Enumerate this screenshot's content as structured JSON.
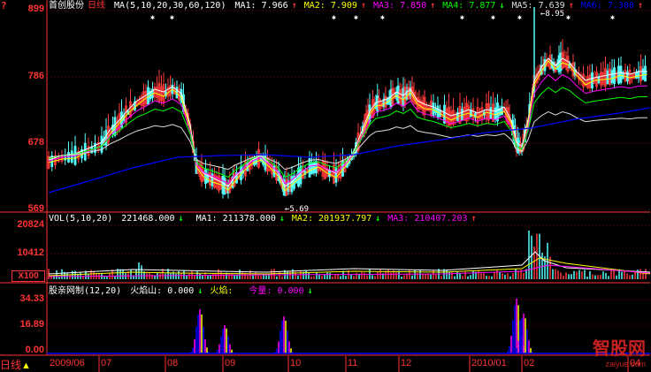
{
  "colors": {
    "up": "#ff3a3a",
    "down": "#54ffff",
    "ma1": "#ffffff",
    "ma2": "#ffff00",
    "ma3": "#ff00ff",
    "ma4": "#00ff00",
    "ma5": "#dddddd",
    "ma6": "#0000ff",
    "grid": "#8b0000",
    "axis": "#ff3333",
    "vol_ma1": "#ffffff",
    "vol_ma2": "#ffff00",
    "vol_ma3": "#ff00ff",
    "ind1": "#ffff00",
    "ind2": "#ff00ff",
    "ind3": "#0000ff"
  },
  "corner_icon": "?",
  "main_panel": {
    "y_labels": [
      "899",
      "786",
      "678",
      "569"
    ],
    "header": {
      "stock": "首创股份",
      "period": "日线",
      "ma_def": "MA(5,10,20,30,60,120)",
      "items": [
        {
          "label": "MA1:",
          "value": "7.966",
          "arrow": "↑",
          "color": "#ffffff"
        },
        {
          "label": "MA2:",
          "value": "7.909",
          "arrow": "↑",
          "color": "#ffff00"
        },
        {
          "label": "MA3:",
          "value": "7.850",
          "arrow": "↑",
          "color": "#ff00ff"
        },
        {
          "label": "MA4:",
          "value": "7.877",
          "arrow": "↓",
          "color": "#00ff00"
        },
        {
          "label": "MA5:",
          "value": "7.639",
          "arrow": "↑",
          "color": "#dddddd"
        },
        {
          "label": "MA6:",
          "value": "7.300",
          "arrow": "↑",
          "color": "#0000ff"
        }
      ]
    },
    "high_mark": "8.95",
    "low_mark": "5.69"
  },
  "vol_panel": {
    "y_labels": [
      "20824",
      "10412",
      "X100"
    ],
    "header": {
      "def": "VOL(5,10,20)",
      "value": "221468.000",
      "value_arrow": "↓",
      "items": [
        {
          "label": "MA1:",
          "value": "211378.000",
          "arrow": "↓",
          "color": "#ffffff"
        },
        {
          "label": "MA2:",
          "value": "201937.797",
          "arrow": "↓",
          "color": "#ffff00"
        },
        {
          "label": "MA3:",
          "value": "210407.203",
          "arrow": "↑",
          "color": "#ff00ff"
        }
      ]
    }
  },
  "ind_panel": {
    "y_labels": [
      "34.33",
      "16.89",
      "0.00"
    ],
    "header": {
      "name": "股亲网制(12,20)",
      "items": [
        {
          "label": "火焰山:",
          "value": "0.000",
          "arrow": "↓",
          "color": "#ffffff"
        },
        {
          "label": "火焰:",
          "value": "",
          "arrow": "",
          "color": "#ffff00"
        },
        {
          "label": "今量:",
          "value": "0.000",
          "arrow": "↓",
          "color": "#ff00ff"
        }
      ]
    }
  },
  "x_axis": [
    "2009/06",
    "07",
    "08",
    "09",
    "10",
    "11",
    "12",
    "2010/01",
    "02",
    "04"
  ],
  "bottom_left": "日线",
  "watermark": {
    "brand": "智股网",
    "url": "zaiyue.com"
  }
}
